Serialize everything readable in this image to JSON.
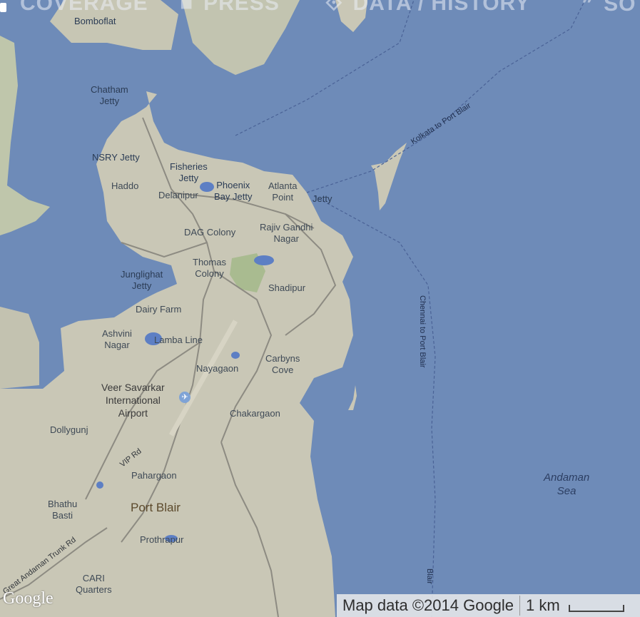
{
  "nav": {
    "items": [
      {
        "label": "COVERAGE",
        "icon": "document-icon",
        "glyph": ""
      },
      {
        "label": "PRESS",
        "icon": "square-icon",
        "glyph": "■"
      },
      {
        "label": "DATA / HISTORY",
        "icon": "layers-icon",
        "glyph": "⟐"
      },
      {
        "label": "SO",
        "icon": "quote-icon",
        "glyph": "❞"
      }
    ]
  },
  "map": {
    "colors": {
      "water": "#6e8bb8",
      "land": "#c9c7b6",
      "park": "#a8bb8e",
      "road": "#8d8b82",
      "lake": "#5d7fc4"
    },
    "places": {
      "bomboo": "Bomboflat",
      "chatham": "Chatham\nJetty",
      "nsry": "NSRY Jetty",
      "fisheries": "Fisheries\nJetty",
      "haddo": "Haddo",
      "delanipur": "Delanipur",
      "phoenix": "Phoenix\nBay Jetty",
      "atlanta": "Atlanta\nPoint",
      "jetty": "Jetty",
      "rajiv": "Rajiv Gandhi\nNagar",
      "dag": "DAG Colony",
      "thomas": "Thomas\nColony",
      "junglighat": "Junglighat\nJetty",
      "shadipur": "Shadipur",
      "dairy": "Dairy Farm",
      "ashvini": "Ashvini\nNagar",
      "lamba": "Lamba Line",
      "carbyns": "Carbyns\nCove",
      "nayagaon": "Nayagaon",
      "airport": "Veer Savarkar\nInternational\nAirport",
      "chakargaon": "Chakargaon",
      "dollygunj": "Dollygunj",
      "pahargaon": "Pahargaon",
      "portblair": "Port Blair",
      "bhathu": "Bhathu\nBasti",
      "prothrapur": "Prothrapur",
      "cari": "CARI\nQuarters",
      "andaman": "Andaman\nSea"
    },
    "routes": {
      "kolkata": "Kolkata to Port Blair",
      "chennai": "Chennai to Port Blair",
      "blair": "Blair"
    },
    "roads": {
      "vip": "VIP Rd",
      "trunk": "Great Andaman Trunk Rd"
    }
  },
  "footer": {
    "logo": "Google",
    "attribution": "Map data ©2014 Google",
    "scale": "1 km"
  }
}
